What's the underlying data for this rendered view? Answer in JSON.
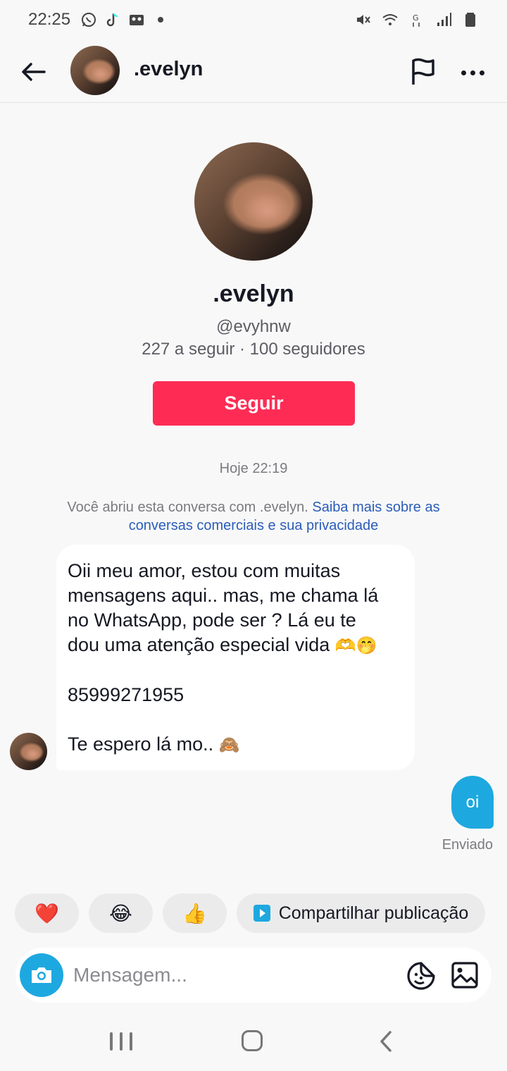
{
  "status_bar": {
    "time": "22:25",
    "left_icons": [
      "whatsapp-icon",
      "tiktok-icon",
      "voicemail-icon",
      "notification-dot-icon"
    ],
    "right_icons": [
      "mute-icon",
      "wifi-icon",
      "network-g-icon",
      "signal-icon",
      "battery-icon"
    ]
  },
  "header": {
    "name": ".evelyn",
    "icons": [
      "back-arrow-icon",
      "flag-icon",
      "more-dots-icon"
    ]
  },
  "profile": {
    "name": ".evelyn",
    "handle": "@evyhnw",
    "stats": "227 a seguir · 100 seguidores",
    "follow_label": "Seguir"
  },
  "conversation": {
    "date_label": "Hoje 22:19",
    "privacy_text": "Você abriu esta conversa com .evelyn. ",
    "privacy_link": "Saiba mais sobre as conversas comerciais e sua privacidade",
    "incoming_message": {
      "line1": "Oii meu amor, estou com muitas",
      "line2": "mensagens aqui.. mas, me chama lá",
      "line3": "no WhatsApp, pode ser ? Lá eu te",
      "line4": "dou uma atenção especial vida",
      "line4_emoji": "🫶🤭",
      "line5": "85999271955",
      "line6": "Te espero lá mo..",
      "line6_emoji": "🙈"
    },
    "outgoing_message": "oi",
    "sent_label": "Enviado"
  },
  "quick_replies": {
    "heart": "❤️",
    "laugh": "😂",
    "thumbs_up": "👍",
    "share_label": "Compartilhar publicação"
  },
  "composer": {
    "placeholder": "Mensagem...",
    "icons": [
      "camera-icon",
      "sticker-icon",
      "gallery-icon"
    ]
  },
  "colors": {
    "follow_button": "#fe2c55",
    "outgoing_bubble": "#1ea8e0",
    "link": "#2b5db9",
    "background": "#f8f8f8"
  }
}
